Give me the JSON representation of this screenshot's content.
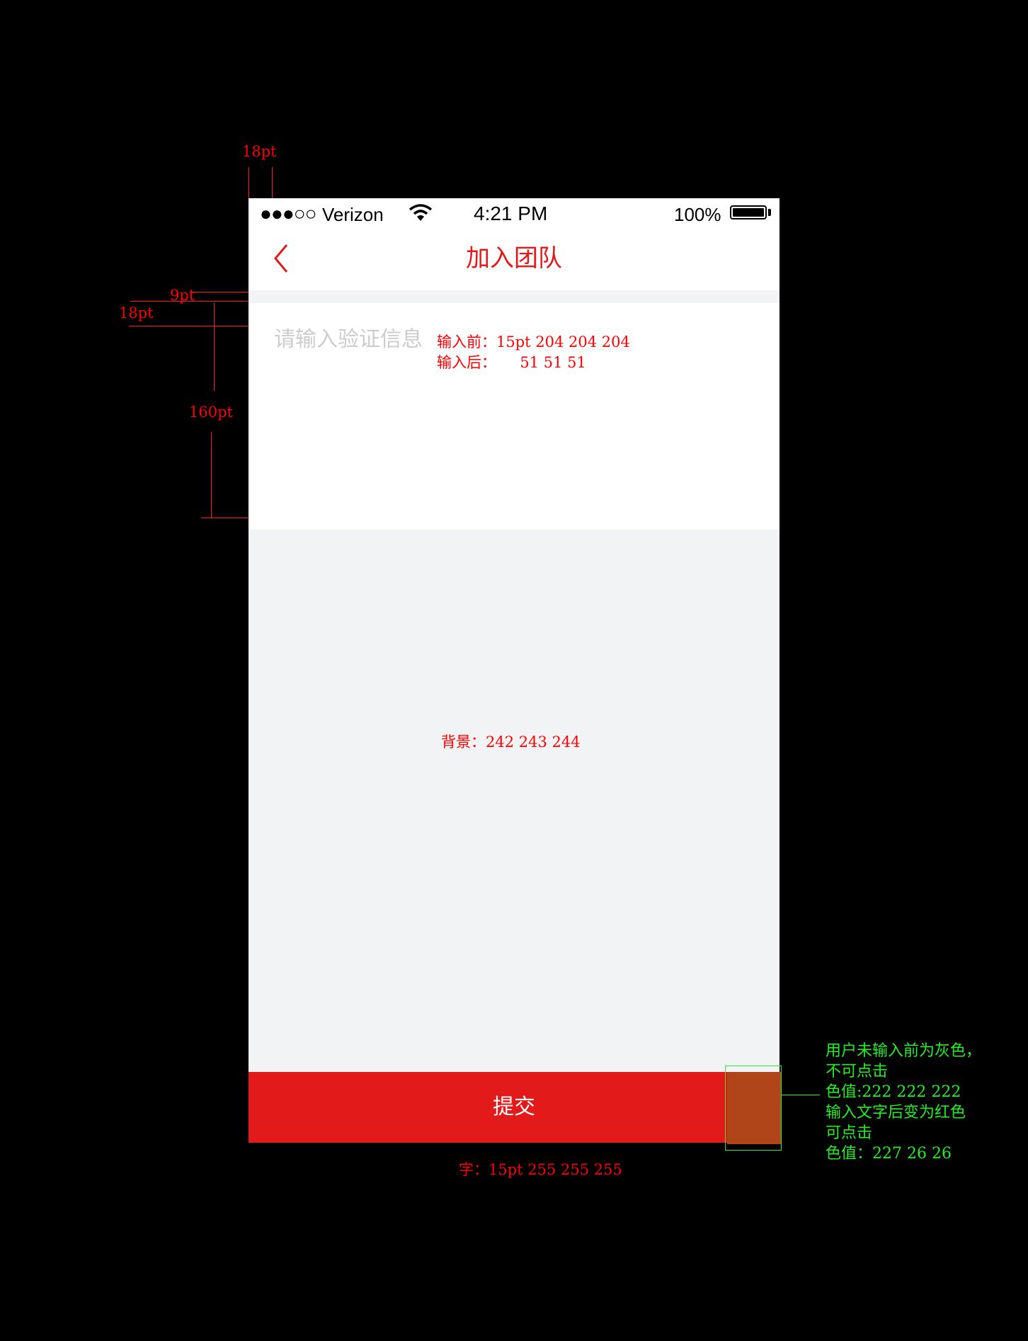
{
  "status_bar": {
    "signal": "●●●○○",
    "carrier": "Verizon",
    "time": "4:21 PM",
    "battery": "100%"
  },
  "nav": {
    "title": "加入团队",
    "back_icon": "chevron-left-icon"
  },
  "form": {
    "placeholder": "请输入验证信息",
    "value": ""
  },
  "submit": {
    "label": "提交"
  },
  "colors": {
    "accent_red": "#e31a1a",
    "background": "#f2f3f4",
    "placeholder": "#cccccc",
    "input_text": "#333333",
    "disabled_button": "#dedede"
  },
  "annotations": {
    "dim_18pt_top": "18pt",
    "dim_9pt": "9pt",
    "dim_18pt_left": "18pt",
    "dim_160pt": "160pt",
    "input_before": "输入前：15pt 204 204 204",
    "input_after": "输入后：     51 51 51",
    "background": "背景：242 243 244",
    "font": "字：15pt 255 255 255",
    "button_note": [
      "用户未输入前为灰色，",
      "不可点击",
      "色值:222 222 222",
      "输入文字后变为红色",
      "可点击",
      "色值：227 26 26"
    ]
  }
}
